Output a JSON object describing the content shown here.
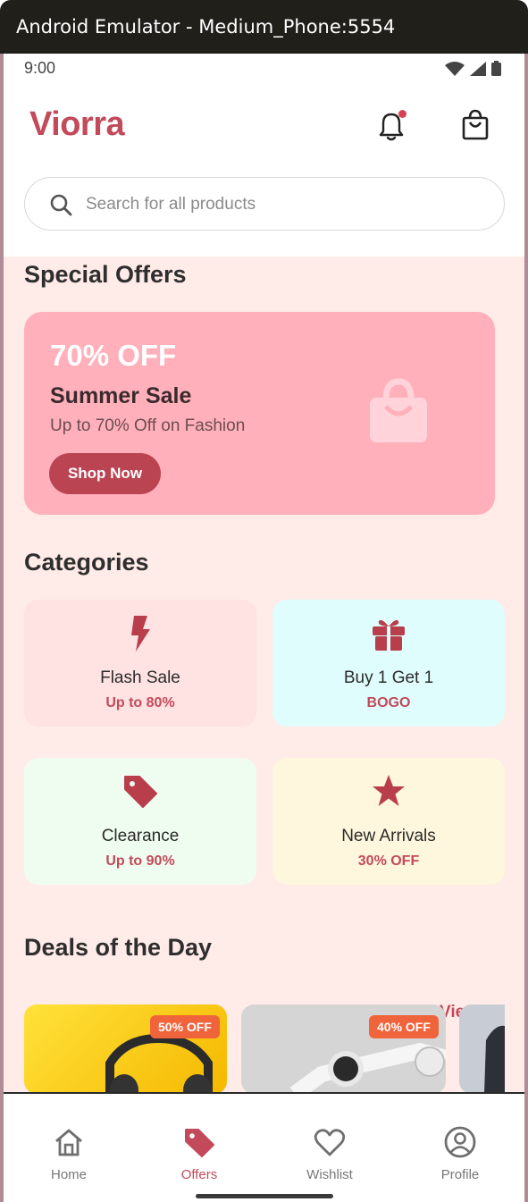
{
  "window": {
    "title": "Android Emulator - Medium_Phone:5554"
  },
  "status_bar": {
    "time": "9:00",
    "icons": [
      "wifi-icon",
      "signal-icon",
      "battery-icon"
    ]
  },
  "header": {
    "logo": "Viorra",
    "icons": [
      "bell-icon",
      "shopping-bag-icon"
    ],
    "has_notification": true
  },
  "search": {
    "placeholder": "Search for all products",
    "value": ""
  },
  "special_offers": {
    "title": "Special Offers",
    "banner": {
      "discount": "70% OFF",
      "title": "Summer Sale",
      "subtitle": "Up to 70% Off on Fashion",
      "button_label": "Shop Now",
      "icon": "shopping-bag-icon"
    }
  },
  "categories": {
    "title": "Categories",
    "items": [
      {
        "title": "Flash Sale",
        "subtitle": "Up to 80%",
        "icon": "lightning-icon",
        "bg": "#ffe2e2"
      },
      {
        "title": "Buy 1 Get 1",
        "subtitle": "BOGO",
        "icon": "gift-icon",
        "bg": "#e0fdfd"
      },
      {
        "title": "Clearance",
        "subtitle": "Up to 90%",
        "icon": "tag-icon",
        "bg": "#effdf0"
      },
      {
        "title": "New Arrivals",
        "subtitle": "30% OFF",
        "icon": "star-icon",
        "bg": "#fff7dd"
      }
    ]
  },
  "deals": {
    "title": "Deals of the Day",
    "view_all_label": "View All",
    "items": [
      {
        "badge": "50% OFF",
        "image": "headphones-image"
      },
      {
        "badge": "40% OFF",
        "image": "smartwatch-image"
      },
      {
        "badge": "",
        "image": "jacket-image"
      }
    ]
  },
  "bottom_nav": {
    "items": [
      {
        "label": "Home",
        "icon": "home-icon",
        "active": false
      },
      {
        "label": "Offers",
        "icon": "tag-icon",
        "active": true
      },
      {
        "label": "Wishlist",
        "icon": "heart-icon",
        "active": false
      },
      {
        "label": "Profile",
        "icon": "profile-icon",
        "active": false
      }
    ]
  },
  "colors": {
    "brand": "#c24a5a",
    "banner_bg": "#ffb0ba",
    "content_bg": "#ffebe7",
    "badge": "#f0643c"
  }
}
